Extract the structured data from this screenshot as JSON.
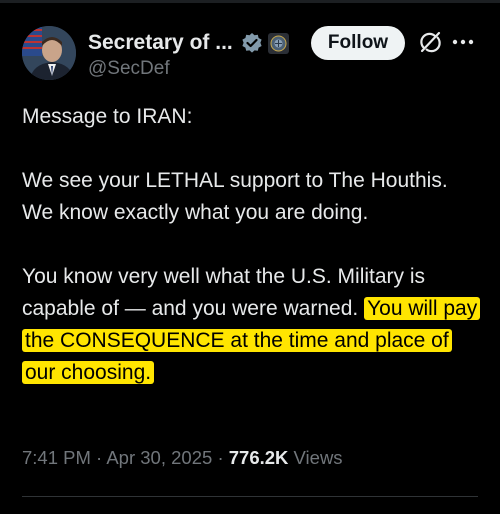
{
  "header": {
    "display_name": "Secretary of ...",
    "handle": "@SecDef",
    "follow_label": "Follow"
  },
  "tweet": {
    "line1": "Message to IRAN:",
    "para2": "We see your LETHAL support to The Houthis. We know exactly what you are doing.",
    "para3_plain": "You know very well what the U.S. Military is capable of — and you were warned.",
    "para3_highlight": "You will pay the CONSEQUENCE at the time and place of our choosing."
  },
  "meta": {
    "time": "7:41 PM",
    "sep1": "·",
    "date": "Apr 30, 2025",
    "sep2": "·",
    "views_count": "776.2K",
    "views_label": "Views"
  },
  "colors": {
    "background": "#000000",
    "text": "#e7e9ea",
    "secondary": "#71767b",
    "verified_badge": "#829aab",
    "highlight": "#ffe500"
  },
  "icons": {
    "verified": "verified-badge-icon",
    "affiliation": "government-seal-icon",
    "grok": "grok-icon",
    "more": "more-dots-icon"
  }
}
